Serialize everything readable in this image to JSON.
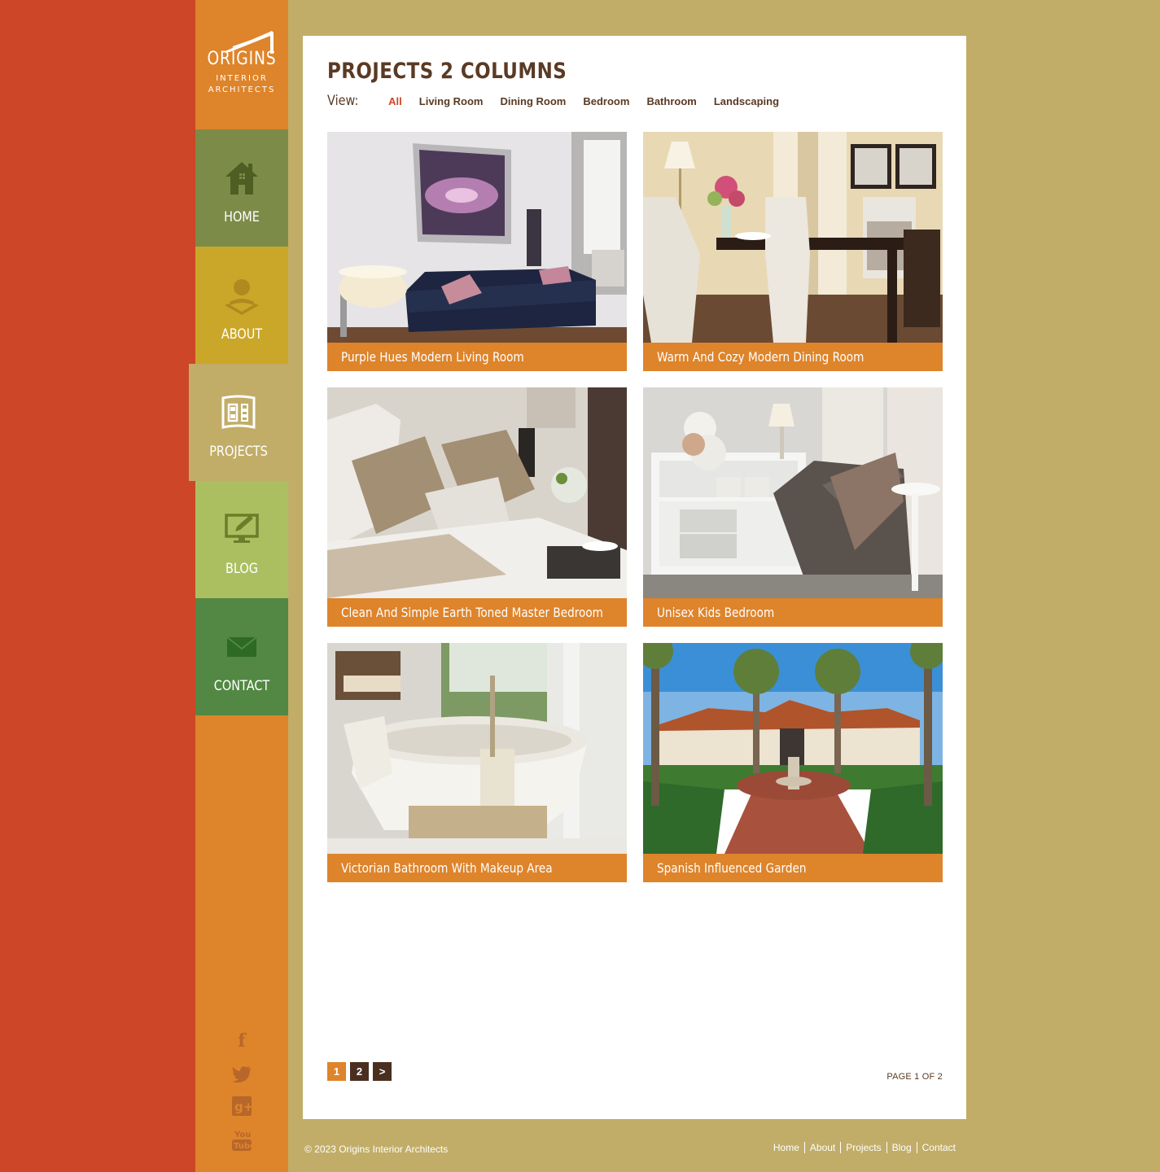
{
  "brand": {
    "name": "ORIGINS",
    "tagline_1": "INTERIOR",
    "tagline_2": "ARCHITECTS"
  },
  "nav": {
    "home": "HOME",
    "about": "ABOUT",
    "projects": "PROJECTS",
    "blog": "BLOG",
    "contact": "CONTACT",
    "active": "projects"
  },
  "social": [
    "facebook-icon",
    "twitter-icon",
    "google-plus-icon",
    "youtube-icon"
  ],
  "page": {
    "title": "PROJECTS 2 COLUMNS",
    "view_label": "View:",
    "filters": [
      "All",
      "Living Room",
      "Dining Room",
      "Bedroom",
      "Bathroom",
      "Landscaping"
    ],
    "active_filter": "All"
  },
  "projects": [
    {
      "title": "Purple Hues Modern Living Room"
    },
    {
      "title": "Warm And Cozy Modern Dining Room"
    },
    {
      "title": "Clean And Simple Earth Toned Master Bedroom"
    },
    {
      "title": "Unisex Kids Bedroom"
    },
    {
      "title": "Victorian Bathroom With Makeup Area"
    },
    {
      "title": "Spanish Influenced Garden"
    }
  ],
  "pagination": {
    "pages": [
      "1",
      "2"
    ],
    "next": ">",
    "current": "1",
    "status": "PAGE 1 OF 2"
  },
  "footer": {
    "copyright": "© 2023 Origins Interior Architects",
    "links": [
      "Home",
      "About",
      "Projects",
      "Blog",
      "Contact"
    ]
  },
  "colors": {
    "red": "#cd4627",
    "orange": "#de842b",
    "olive": "#7d8b48",
    "mustard": "#cba729",
    "tan": "#c1ad67",
    "lime": "#acbf60",
    "green": "#528843",
    "brown": "#5a3a24"
  }
}
